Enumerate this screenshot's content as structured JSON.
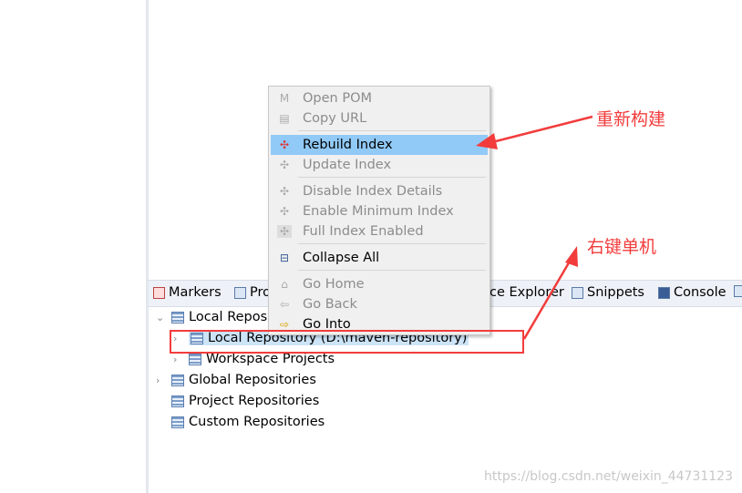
{
  "tabs": [
    {
      "label": "Markers",
      "icon": "markers-icon"
    },
    {
      "label": "Pro",
      "icon": "properties-icon"
    },
    {
      "label": "ce Explorer",
      "icon": "explorer-icon"
    },
    {
      "label": "Snippets",
      "icon": "snippets-icon"
    },
    {
      "label": "Console",
      "icon": "console-icon"
    }
  ],
  "tree": [
    {
      "label": "Local Repos",
      "expanded": true
    },
    {
      "label": "Local Repository (D:\\maven-repository)",
      "selected": true
    },
    {
      "label": "Workspace Projects"
    },
    {
      "label": "Global Repositories"
    },
    {
      "label": "Project Repositories"
    },
    {
      "label": "Custom Repositories"
    }
  ],
  "menu": [
    {
      "label": "Open POM",
      "enabled": false,
      "icon": "pom-icon"
    },
    {
      "label": "Copy URL",
      "enabled": false,
      "icon": "copy-icon"
    },
    {
      "label": "Rebuild Index",
      "enabled": true,
      "highlighted": true,
      "icon": "rebuild-index-icon"
    },
    {
      "label": "Update Index",
      "enabled": false,
      "icon": "update-index-icon"
    },
    {
      "label": "Disable Index Details",
      "enabled": false,
      "icon": "index-icon"
    },
    {
      "label": "Enable Minimum Index",
      "enabled": false,
      "icon": "index-icon"
    },
    {
      "label": "Full Index Enabled",
      "enabled": false,
      "icon": "index-icon"
    },
    {
      "label": "Collapse All",
      "enabled": true,
      "icon": "collapse-all-icon"
    },
    {
      "label": "Go Home",
      "enabled": false,
      "icon": "home-icon"
    },
    {
      "label": "Go Back",
      "enabled": false,
      "icon": "back-icon"
    },
    {
      "label": "Go Into",
      "enabled": true,
      "icon": "go-into-icon"
    }
  ],
  "annotations": {
    "rebuild": "重新构建",
    "rightclick": "右键单机",
    "color": "#f23c3c"
  },
  "watermark": "https://blog.csdn.net/weixin_44731123"
}
